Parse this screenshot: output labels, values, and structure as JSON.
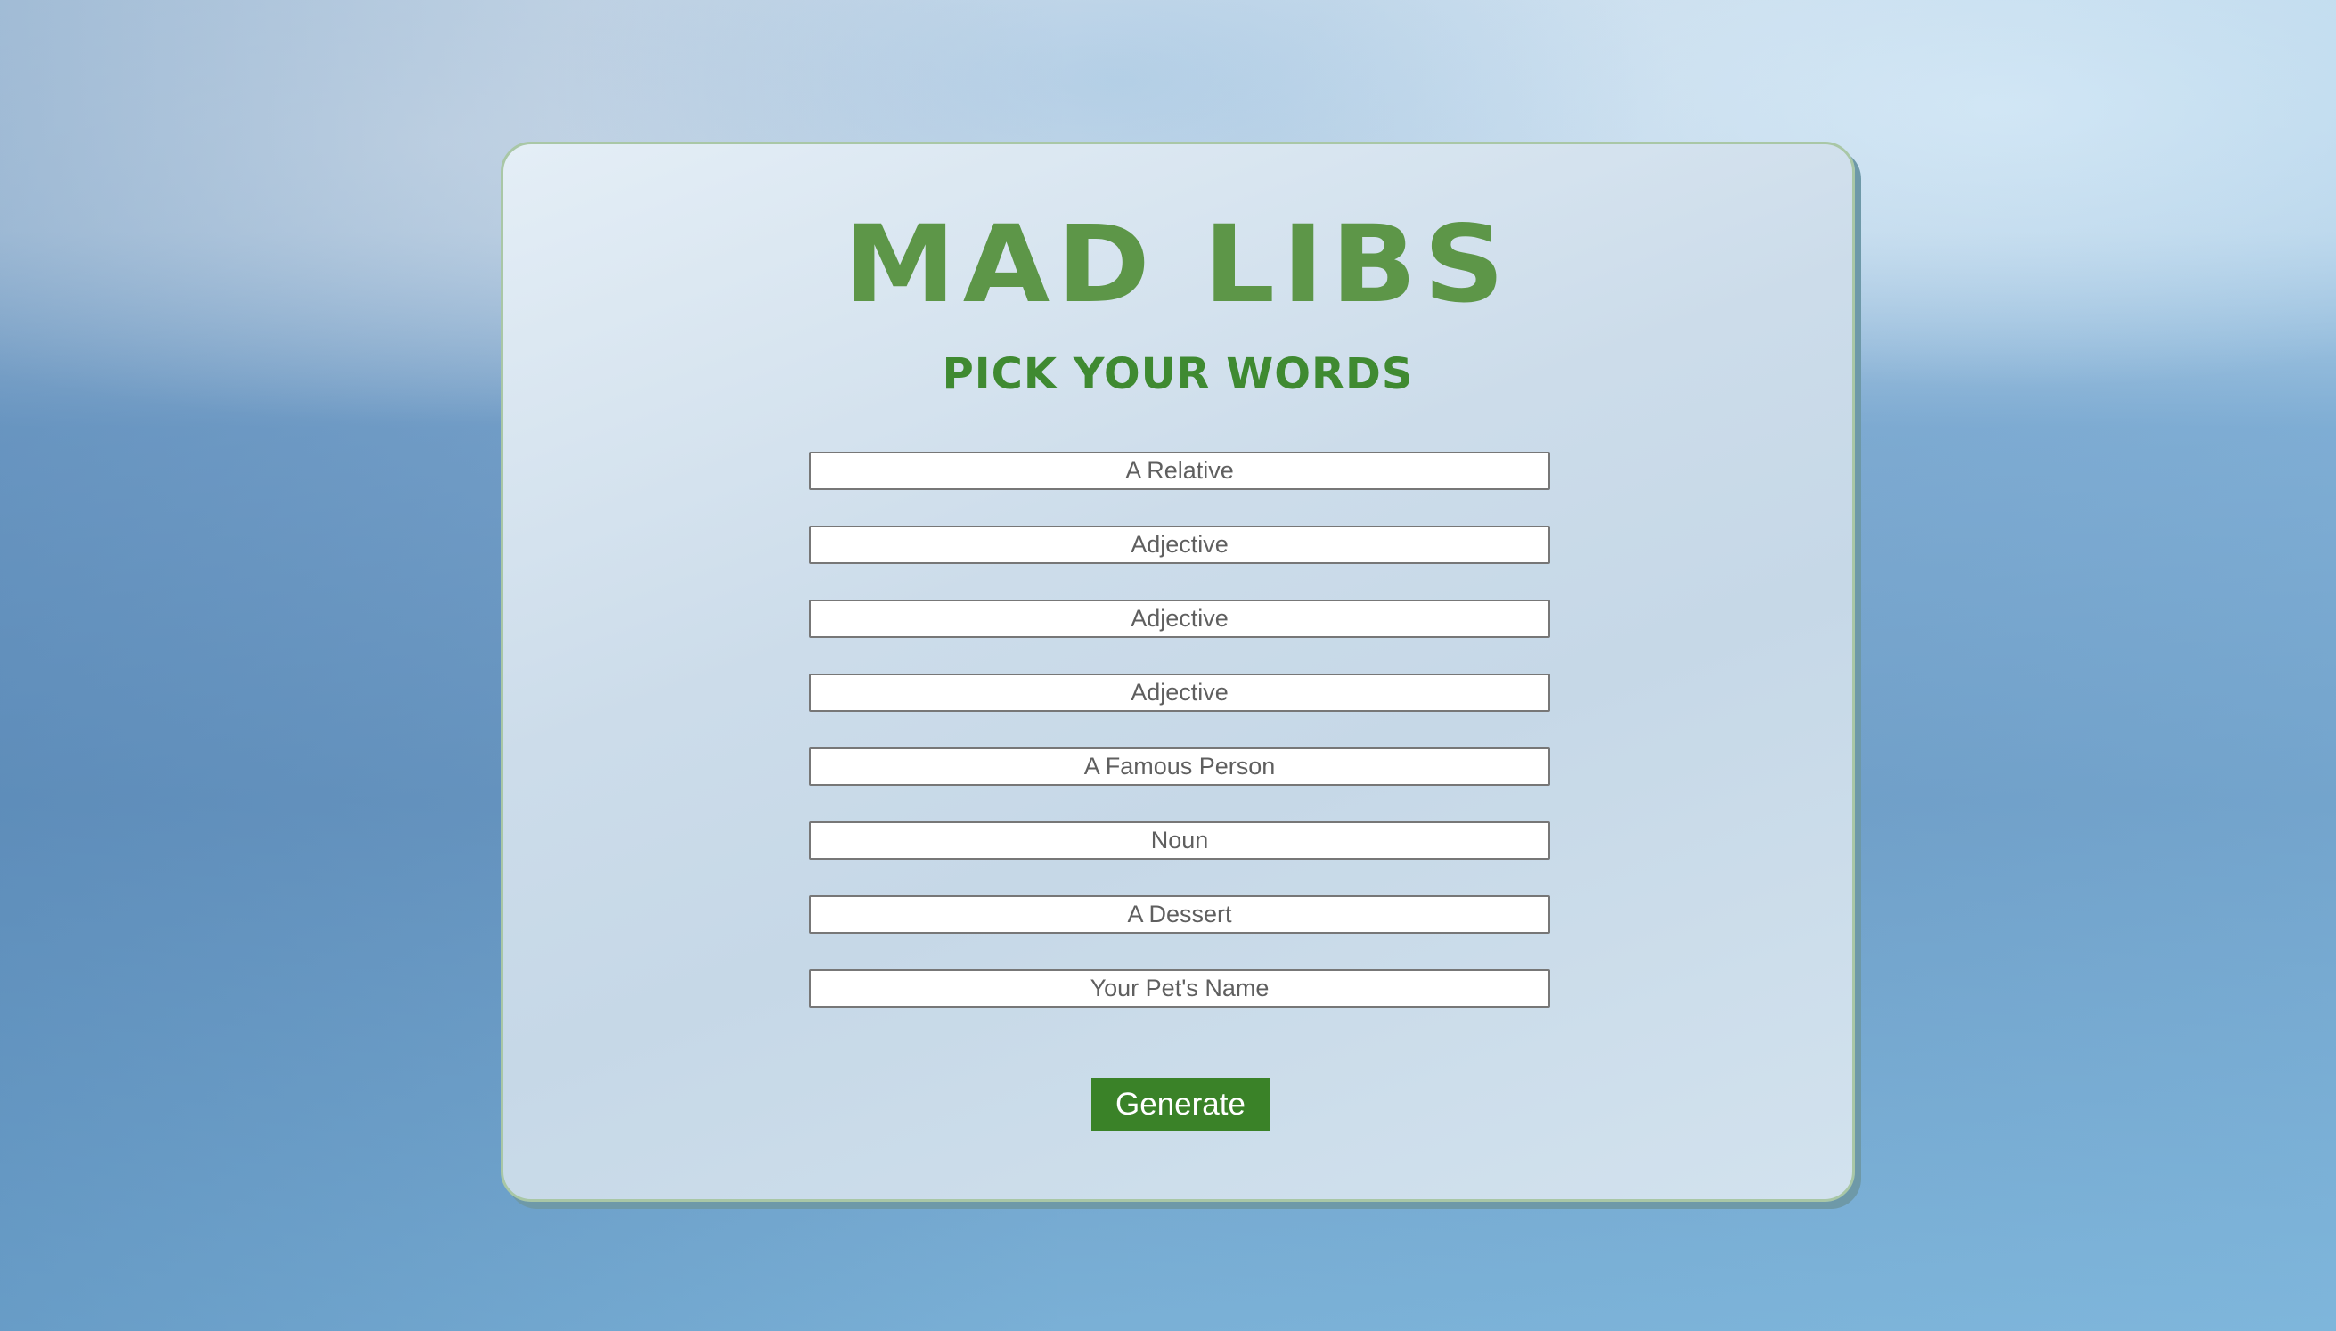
{
  "header": {
    "title": "MAD LIBS",
    "subtitle": "PICK YOUR WORDS"
  },
  "form": {
    "fields": [
      {
        "placeholder": "A Relative",
        "value": ""
      },
      {
        "placeholder": "Adjective",
        "value": ""
      },
      {
        "placeholder": "Adjective",
        "value": ""
      },
      {
        "placeholder": "Adjective",
        "value": ""
      },
      {
        "placeholder": "A Famous Person",
        "value": ""
      },
      {
        "placeholder": "Noun",
        "value": ""
      },
      {
        "placeholder": "A Dessert",
        "value": ""
      },
      {
        "placeholder": "Your Pet's Name",
        "value": ""
      }
    ],
    "generate_label": "Generate"
  },
  "colors": {
    "title": "#5d9648",
    "subtitle": "#3f8a31",
    "button": "#3a8228",
    "card_border": "#a9c7a6"
  }
}
